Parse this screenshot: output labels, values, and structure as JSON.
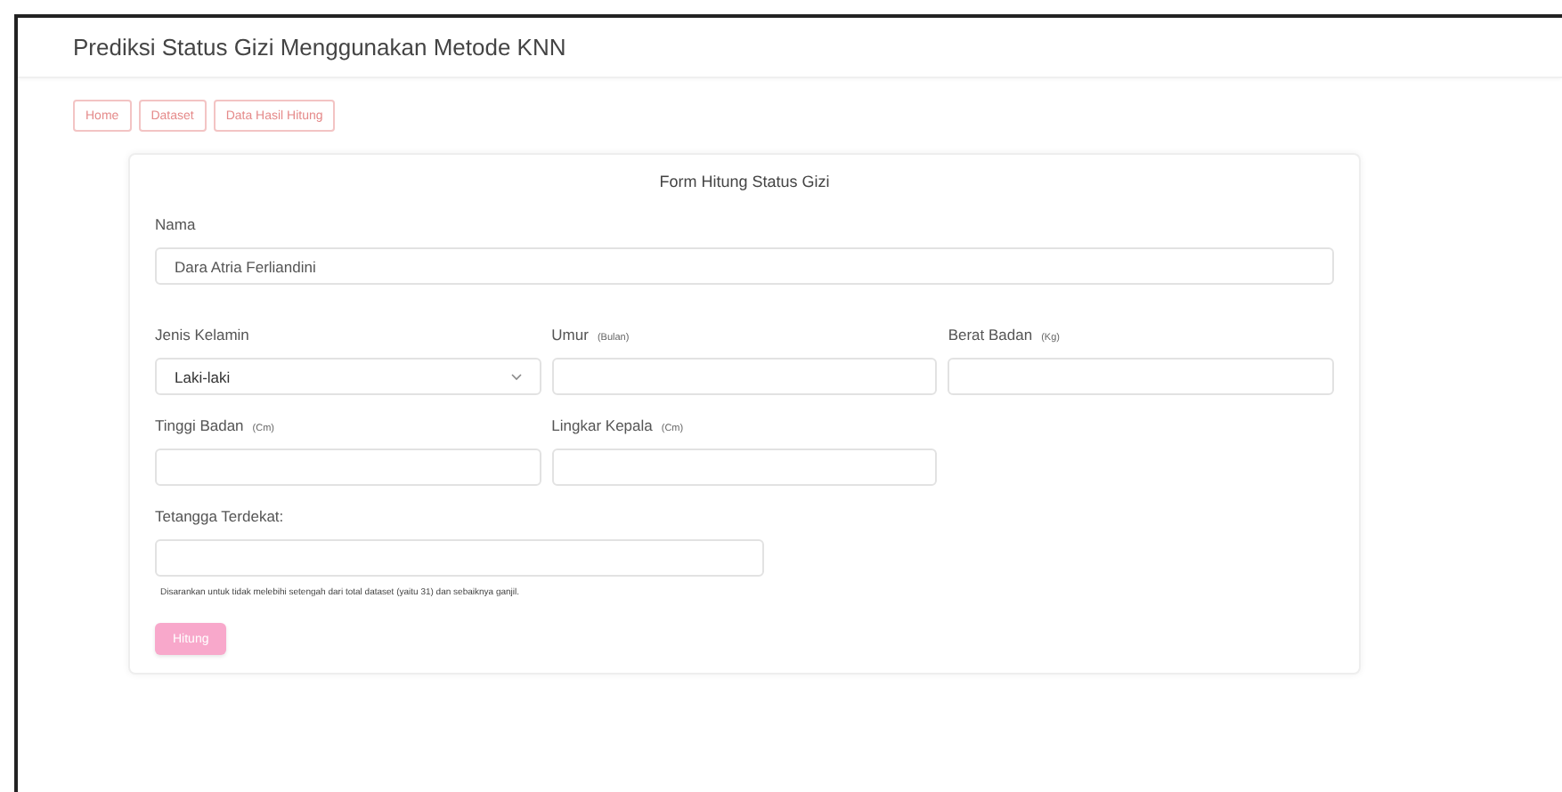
{
  "header": {
    "title": "Prediksi Status Gizi Menggunakan Metode KNN"
  },
  "nav": [
    {
      "label": "Home"
    },
    {
      "label": "Dataset"
    },
    {
      "label": "Data Hasil Hitung"
    }
  ],
  "form": {
    "title": "Form Hitung Status Gizi",
    "rows": [
      {
        "fields": [
          {
            "kind": "text",
            "label": "Nama",
            "value": "Dara Atria Ferliandini"
          }
        ]
      },
      {
        "fields": [
          {
            "kind": "select",
            "label": "Jenis Kelamin",
            "value": "Laki-laki"
          },
          {
            "kind": "text",
            "label": "Umur",
            "unit": "(Bulan)"
          },
          {
            "kind": "text",
            "label": "Berat Badan",
            "unit": "(Kg)"
          }
        ]
      },
      {
        "fields": [
          {
            "kind": "text",
            "label": "Tinggi Badan",
            "unit": "(Cm)"
          },
          {
            "kind": "text",
            "label": "Lingkar Kepala",
            "unit": "(Cm)"
          }
        ]
      }
    ],
    "neighbors": {
      "label": "Tetangga Terdekat:",
      "hint": "Disarankan untuk tidak melebihi setengah dari total dataset (yaitu 31) dan sebaiknya ganjil."
    },
    "submit": {
      "label": "Hitung",
      "disabled": true
    }
  }
}
